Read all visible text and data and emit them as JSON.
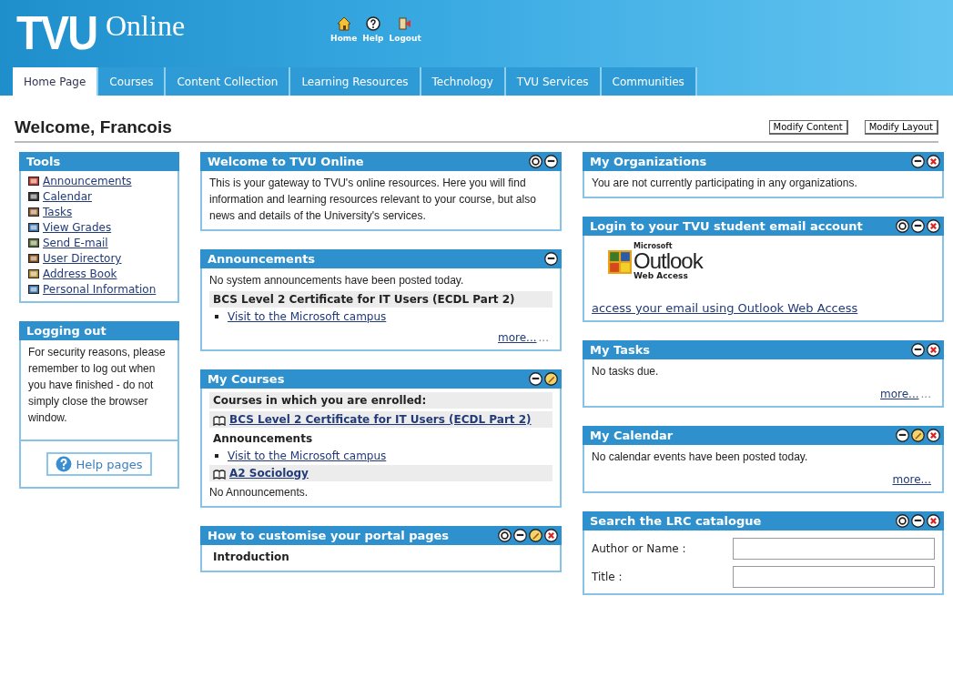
{
  "header": {
    "logo": "TVU",
    "logo_suffix": "Online",
    "nav": [
      {
        "kind": "home",
        "label": "Home"
      },
      {
        "kind": "help",
        "label": "Help"
      },
      {
        "kind": "logout",
        "label": "Logout"
      }
    ]
  },
  "tabs": [
    {
      "label": "Home Page",
      "selected": true
    },
    {
      "label": "Courses",
      "selected": false
    },
    {
      "label": "Content Collection",
      "selected": false
    },
    {
      "label": "Learning Resources",
      "selected": false
    },
    {
      "label": "Technology",
      "selected": false
    },
    {
      "label": "TVU Services",
      "selected": false
    },
    {
      "label": "Communities",
      "selected": false
    }
  ],
  "welcome": "Welcome, Francois",
  "actions": [
    "Modify Content",
    "Modify Layout"
  ],
  "columns": [
    [
      {
        "title": "Tools",
        "blocks": [
          {
            "kind": "tool",
            "text": "Announcements"
          },
          {
            "kind": "tool",
            "text": "Calendar"
          },
          {
            "kind": "tool",
            "text": "Tasks"
          },
          {
            "kind": "tool",
            "text": "View Grades"
          },
          {
            "kind": "tool",
            "text": "Send E-mail"
          },
          {
            "kind": "tool",
            "text": "User Directory"
          },
          {
            "kind": "tool",
            "text": "Address Book"
          },
          {
            "kind": "tool",
            "text": "Personal Information"
          }
        ]
      },
      {
        "title": "Logging out",
        "blocks": [
          {
            "kind": "text",
            "text": "For security reasons, please remember to log out when you have finished - do not simply close the browser window."
          },
          {
            "kind": "help-button",
            "text": "Help pages"
          }
        ]
      }
    ],
    [
      {
        "title": "Welcome to TVU Online",
        "buttons": [
          {
            "kind": "refresh"
          },
          {
            "kind": "minimize"
          }
        ],
        "blocks": [
          {
            "kind": "text",
            "text": "This is your gateway to TVU's online resources. Here you will find information and learning resources relevant to your course, but also news and details of the University's services."
          }
        ]
      },
      {
        "title": "Announcements",
        "buttons": [
          {
            "kind": "minimize"
          }
        ],
        "blocks": [
          {
            "kind": "text",
            "text": "No system announcements have been posted today."
          },
          {
            "kind": "heading",
            "text": "BCS Level 2 Certificate for IT Users (ECDL Part 2)"
          },
          {
            "kind": "bullet",
            "text": "Visit to the Microsoft campus"
          },
          {
            "kind": "more",
            "text": "more...",
            "trail": "..."
          }
        ]
      },
      {
        "title": "My Courses",
        "buttons": [
          {
            "kind": "minimize"
          },
          {
            "kind": "edit"
          }
        ],
        "blocks": [
          {
            "kind": "heading",
            "text": "Courses in which you are enrolled:"
          },
          {
            "kind": "course",
            "text": "BCS Level 2 Certificate for IT Users (ECDL Part 2)"
          },
          {
            "kind": "subheading",
            "text": "Announcements"
          },
          {
            "kind": "bullet",
            "text": "Visit to the Microsoft campus"
          },
          {
            "kind": "course",
            "text": "A2 Sociology"
          },
          {
            "kind": "text",
            "text": "No Announcements."
          }
        ]
      },
      {
        "title": "How to customise your portal pages",
        "buttons": [
          {
            "kind": "refresh"
          },
          {
            "kind": "minimize"
          },
          {
            "kind": "edit"
          },
          {
            "kind": "close"
          }
        ],
        "blocks": [
          {
            "kind": "subheading",
            "text": "Introduction"
          }
        ]
      }
    ],
    [
      {
        "title": "My Organizations",
        "buttons": [
          {
            "kind": "minimize"
          },
          {
            "kind": "close"
          }
        ],
        "blocks": [
          {
            "kind": "text",
            "text": "You are not currently participating in any organizations."
          }
        ]
      },
      {
        "title": "Login to your TVU student email account",
        "buttons": [
          {
            "kind": "refresh"
          },
          {
            "kind": "minimize"
          },
          {
            "kind": "close"
          }
        ],
        "blocks": [
          {
            "kind": "logo",
            "small": "Microsoft",
            "text": "Outlook",
            "sub": "Web Access"
          },
          {
            "kind": "link",
            "text": "access your email using Outlook Web Access"
          }
        ]
      },
      {
        "title": "My Tasks",
        "buttons": [
          {
            "kind": "minimize"
          },
          {
            "kind": "close"
          }
        ],
        "blocks": [
          {
            "kind": "text",
            "text": "No tasks due."
          },
          {
            "kind": "more",
            "text": "more...",
            "trail": "..."
          }
        ]
      },
      {
        "title": "My Calendar",
        "buttons": [
          {
            "kind": "minimize"
          },
          {
            "kind": "edit"
          },
          {
            "kind": "close"
          }
        ],
        "blocks": [
          {
            "kind": "text",
            "text": "No calendar events have been posted today."
          },
          {
            "kind": "more",
            "text": "more..."
          }
        ]
      },
      {
        "title": "Search the LRC catalogue",
        "buttons": [
          {
            "kind": "refresh"
          },
          {
            "kind": "minimize"
          },
          {
            "kind": "close"
          }
        ],
        "blocks": [
          {
            "kind": "field",
            "text": "Author or Name :"
          },
          {
            "kind": "field",
            "text": "Title :"
          }
        ]
      }
    ]
  ]
}
